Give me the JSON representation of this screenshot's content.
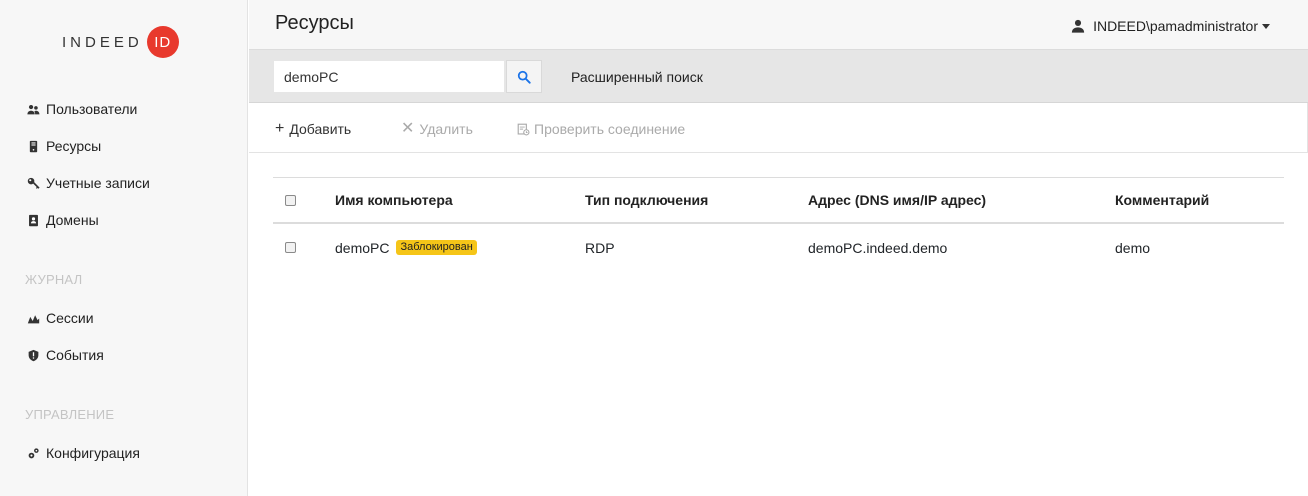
{
  "sidebar": {
    "logo_text": "INDEED",
    "logo_badge": "ID",
    "items": [
      {
        "label": "Пользователи",
        "icon": "users-icon"
      },
      {
        "label": "Ресурсы",
        "icon": "server-icon"
      },
      {
        "label": "Учетные записи",
        "icon": "key-icon"
      },
      {
        "label": "Домены",
        "icon": "address-book-icon"
      }
    ],
    "section_journal": "ЖУРНАЛ",
    "journal_items": [
      {
        "label": "Сессии",
        "icon": "sessions-icon"
      },
      {
        "label": "События",
        "icon": "shield-alert-icon"
      }
    ],
    "section_manage": "УПРАВЛЕНИЕ",
    "manage_items": [
      {
        "label": "Конфигурация",
        "icon": "cogs-icon"
      }
    ]
  },
  "header": {
    "title": "Ресурсы",
    "user": "INDEED\\pamadministrator"
  },
  "search": {
    "value": "demoPC",
    "advanced_label": "Расширенный поиск"
  },
  "toolbar": {
    "add_label": "Добавить",
    "delete_label": "Удалить",
    "check_label": "Проверить соединение"
  },
  "table": {
    "columns": [
      "Имя компьютера",
      "Тип подключения",
      "Адрес (DNS имя/IP адрес)",
      "Комментарий"
    ],
    "rows": [
      {
        "name": "demoPC",
        "badge": "Заблокирован",
        "type": "RDP",
        "address": "demoPC.indeed.demo",
        "comment": "demo"
      }
    ]
  },
  "colors": {
    "accent": "#1a73e8",
    "logo_red": "#e8392d",
    "badge_yellow": "#f5c518",
    "sidebar_bg": "#f7f7f7",
    "search_band_bg": "#e6e6e6"
  }
}
